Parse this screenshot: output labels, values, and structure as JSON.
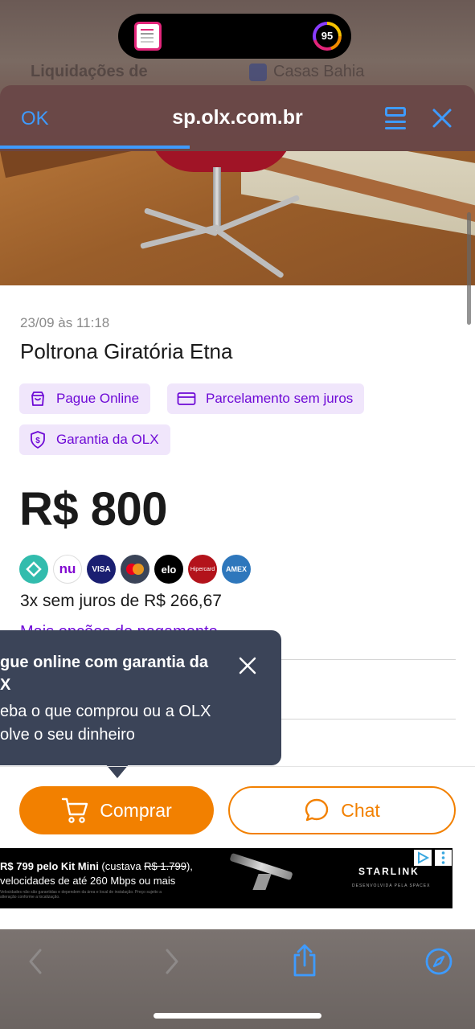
{
  "status_bar": {
    "battery_level": "95"
  },
  "background_page": {
    "left_text": "Liquidações de",
    "right_text": "Casas Bahia"
  },
  "browser": {
    "done_label": "OK",
    "url": "sp.olx.com.br",
    "load_progress": 0.4,
    "icons": {
      "reader": "reader-mode-icon",
      "close": "close-icon"
    }
  },
  "listing": {
    "date": "23/09 às 11:18",
    "title": "Poltrona Giratória Etna",
    "badges": [
      {
        "label": "Pague Online",
        "icon": "shopping-bag-icon"
      },
      {
        "label": "Parcelamento sem juros",
        "icon": "credit-card-icon"
      },
      {
        "label": "Garantia da OLX",
        "icon": "shield-dollar-icon"
      }
    ],
    "price": "R$ 800",
    "payment_methods": [
      "pix",
      "nu",
      "VISA",
      "mastercard",
      "elo",
      "Hipercard",
      "AMEX"
    ],
    "installments": "3x sem juros de R$ 266,67",
    "more_link": "Mais opções de pagamento"
  },
  "tooltip": {
    "title": "gue online com garantia da\nX",
    "body": "eba o que comprou ou a OLX\nolve o seu dinheiro"
  },
  "actions": {
    "buy_label": "Comprar",
    "chat_label": "Chat"
  },
  "ad": {
    "line1_prefix": "R$ 799 pelo Kit Mini",
    "line1_rest": " (custava ",
    "line1_old": "R$ 1.799",
    "line1_end": "),",
    "line2": "velocidades de até 260 Mbps ou mais",
    "fine_print": "Velocidades não são garantidas e dependem da área e local de instalação. Preço sujeito a alteração conforme a localização.",
    "brand": "STARLINK",
    "brand_sub": "DESENVOLVIDA PELA SPACEX"
  },
  "toolbar": {
    "icons": [
      "back-arrow-icon",
      "forward-arrow-icon",
      "share-icon",
      "compass-icon"
    ]
  },
  "colors": {
    "olx_purple": "#6e0ad6",
    "olx_orange": "#f28000",
    "ios_blue": "#3e9bff",
    "tooltip_bg": "#3b4458"
  }
}
